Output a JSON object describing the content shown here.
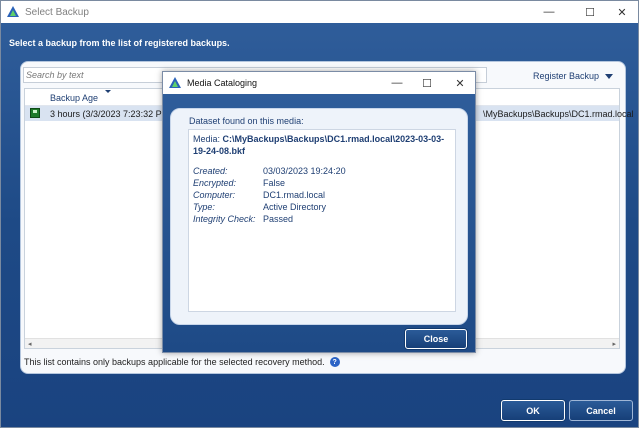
{
  "window": {
    "title": "Select Backup",
    "minimize": "—",
    "maximize": "☐",
    "close": "✕"
  },
  "instruction": "Select a backup from the list of registered backups.",
  "search": {
    "placeholder": "Search by text"
  },
  "register_label": "Register Backup",
  "grid": {
    "column_age": "Backup Age",
    "rows": [
      {
        "age": "3 hours (3/3/2023 7:23:32 PM",
        "path": "\\MyBackups\\Backups\\DC1.rmad.local"
      }
    ]
  },
  "note": "This list contains only backups applicable for the selected recovery method.",
  "help": "?",
  "ok_label": "OK",
  "cancel_label": "Cancel",
  "modal": {
    "title": "Media Cataloging",
    "minimize": "—",
    "maximize": "☐",
    "close": "✕",
    "found": "Dataset found on this media:",
    "media_label": "Media:",
    "media_value": "C:\\MyBackups\\Backups\\DC1.rmad.local\\2023-03-03-19-24-08.bkf",
    "fields": [
      {
        "key": "Created:",
        "value": "03/03/2023 19:24:20"
      },
      {
        "key": "Encrypted:",
        "value": "False"
      },
      {
        "key": "Computer:",
        "value": "DC1.rmad.local"
      },
      {
        "key": "Type:",
        "value": "Active Directory"
      },
      {
        "key": "Integrity Check:",
        "value": "Passed"
      }
    ],
    "close_label": "Close"
  },
  "colors": {
    "accent_dark": "#1a4380",
    "accent": "#2f5d9a",
    "text_blue": "#1f3f73",
    "row_selected": "#d9e3f1"
  }
}
